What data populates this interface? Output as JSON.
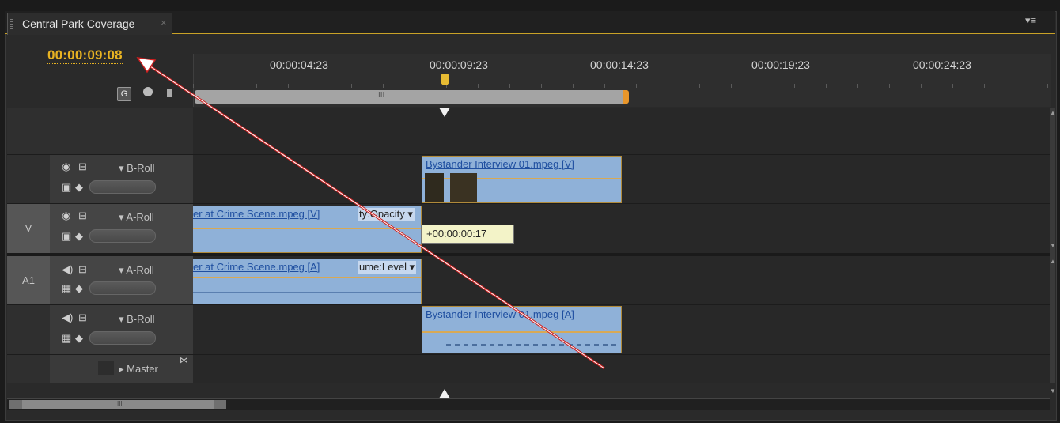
{
  "panel": {
    "tab_title": "Central Park Coverage",
    "tab_close": "×",
    "menu_icon": "panel-menu-icon"
  },
  "timeline": {
    "current_time": "00:00:09:08",
    "ruler_labels": [
      "00:00:04:23",
      "00:00:09:23",
      "00:00:14:23",
      "00:00:19:23",
      "00:00:24:23"
    ],
    "zoom_mark": "III",
    "drag_tooltip": "+00:00:00:17"
  },
  "tracks": {
    "v_label": "V",
    "a1_label": "A1",
    "v2_name": "B-Roll",
    "v1_name": "A-Roll",
    "a1_name": "A-Roll",
    "a2_name": "B-Roll",
    "master_name": "Master"
  },
  "clips": {
    "v2_clip": "Bystander Interview 01.mpeg [V]",
    "v1_clip": "er at Crime Scene.mpeg [V]",
    "v1_effect": "ty:Opacity",
    "a1_clip": "er at Crime Scene.mpeg [A]",
    "a1_effect": "ume:Level",
    "a2_clip": "Bystander Interview 01.mpeg [A]"
  },
  "scroll": {
    "h_mark": "III"
  },
  "colors": {
    "accent": "#e8b322",
    "clip_blue": "#8fb1d8",
    "playhead": "#d44a3f",
    "annotation_arrow": "#cc1f1f"
  }
}
